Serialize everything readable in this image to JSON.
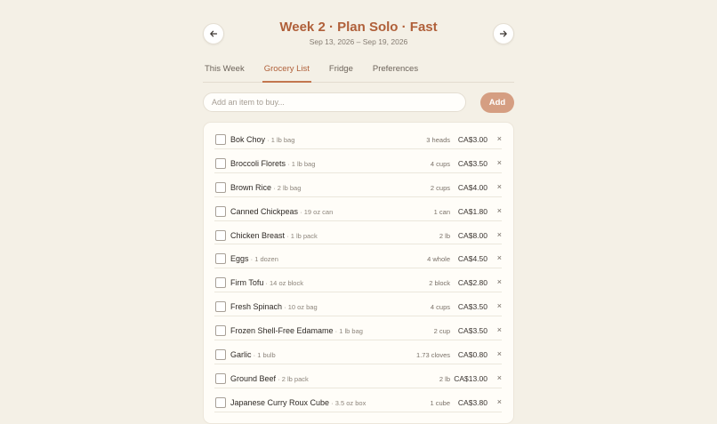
{
  "header": {
    "title": "Week 2 · Plan Solo · Fast",
    "date_range": "Sep 13, 2026 – Sep 19, 2026",
    "prev_icon": "arrow-left-icon",
    "next_icon": "arrow-right-icon"
  },
  "tabs": [
    {
      "label": "This Week",
      "active": false
    },
    {
      "label": "Grocery List",
      "active": true
    },
    {
      "label": "Fridge",
      "active": false
    },
    {
      "label": "Preferences",
      "active": false
    }
  ],
  "add_item": {
    "placeholder": "Add an item to buy...",
    "value": "",
    "button_label": "Add"
  },
  "items": [
    {
      "name": "Bok Choy",
      "package": "1 lb bag",
      "quantity": "3 heads",
      "price": "CA$3.00"
    },
    {
      "name": "Broccoli Florets",
      "package": "1 lb bag",
      "quantity": "4 cups",
      "price": "CA$3.50"
    },
    {
      "name": "Brown Rice",
      "package": "2 lb bag",
      "quantity": "2 cups",
      "price": "CA$4.00"
    },
    {
      "name": "Canned Chickpeas",
      "package": "19 oz can",
      "quantity": "1 can",
      "price": "CA$1.80"
    },
    {
      "name": "Chicken Breast",
      "package": "1 lb pack",
      "quantity": "2 lb",
      "price": "CA$8.00"
    },
    {
      "name": "Eggs",
      "package": "1 dozen",
      "quantity": "4 whole",
      "price": "CA$4.50"
    },
    {
      "name": "Firm Tofu",
      "package": "14 oz block",
      "quantity": "2 block",
      "price": "CA$2.80"
    },
    {
      "name": "Fresh Spinach",
      "package": "10 oz bag",
      "quantity": "4 cups",
      "price": "CA$3.50"
    },
    {
      "name": "Frozen Shell-Free Edamame",
      "package": "1 lb bag",
      "quantity": "2 cup",
      "price": "CA$3.50"
    },
    {
      "name": "Garlic",
      "package": "1 bulb",
      "quantity": "1.73 cloves",
      "price": "CA$0.80"
    },
    {
      "name": "Ground Beef",
      "package": "2 lb pack",
      "quantity": "2 lb",
      "price": "CA$13.00"
    },
    {
      "name": "Japanese Curry Roux Cube",
      "package": "3.5 oz box",
      "quantity": "1 cube",
      "price": "CA$3.80"
    }
  ],
  "colors": {
    "accent": "#b0603a",
    "add_button": "#d59e82",
    "background": "#f4f0e6"
  }
}
